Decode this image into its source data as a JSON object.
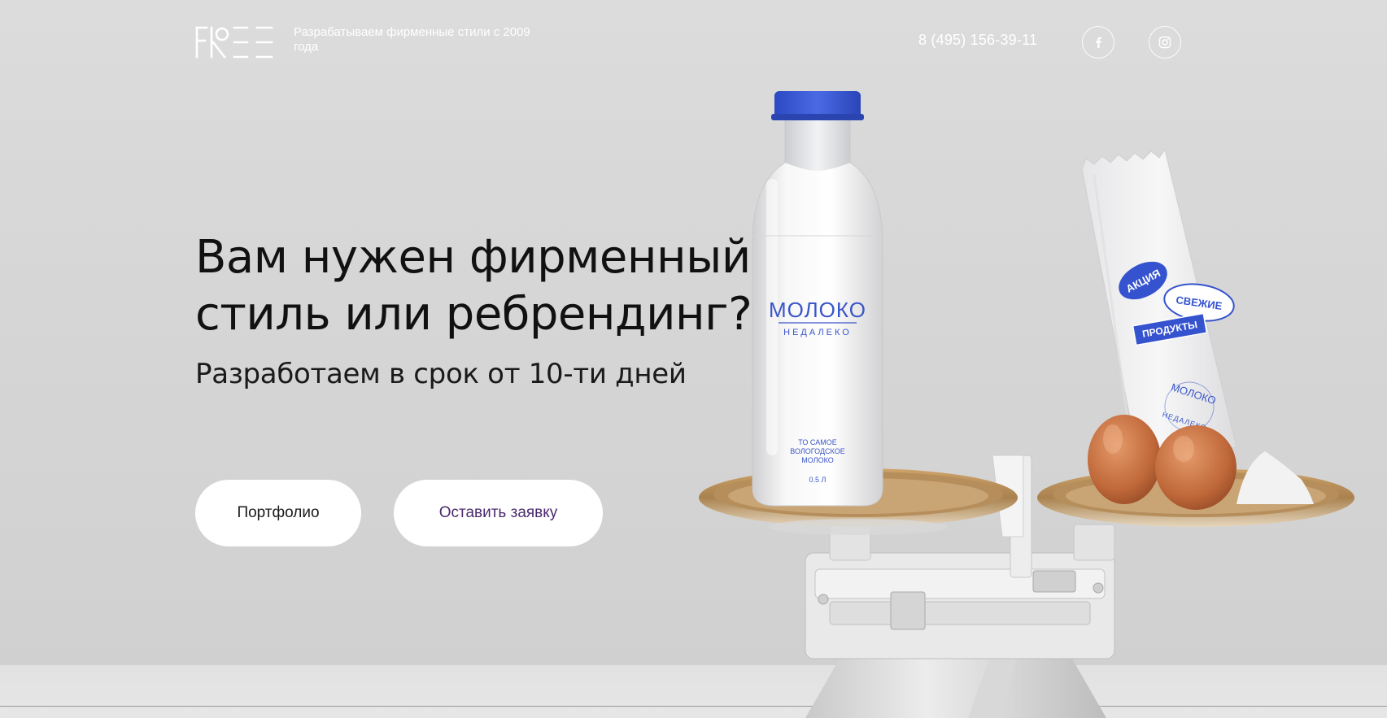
{
  "header": {
    "logo_text": "FREE",
    "tagline": "Разрабатываем фирменные стили с 2009 года",
    "phone": "8 (495) 156-39-11",
    "social": [
      {
        "name": "facebook",
        "icon": "facebook-icon"
      },
      {
        "name": "instagram",
        "icon": "instagram-icon"
      }
    ]
  },
  "hero": {
    "title_line1": "Вам нужен фирменный",
    "title_line2": "стиль или ребрендинг?",
    "subtitle": "Разработаем в срок от 10-ти дней"
  },
  "buttons": {
    "portfolio": "Портфолио",
    "request": "Оставить заявку"
  },
  "illustration": {
    "bottle_brand": "МОЛОКО",
    "bottle_sub": "НЕДАЛЕКО",
    "bottle_note_1": "ТО САМОЕ",
    "bottle_note_2": "ВОЛОГОДСКОЕ",
    "bottle_note_3": "МОЛОКО",
    "bottle_volume": "0.5 Л",
    "bag_badge_1": "АКЦИЯ",
    "bag_badge_2": "СВЕЖИЕ",
    "bag_badge_3": "ПРОДУКТЫ",
    "bag_stamp_1": "МОЛОКО",
    "bag_stamp_2": "НЕДАЛЕКО"
  },
  "colors": {
    "accent_purple": "#4a2a6e",
    "brand_blue": "#3a56c8",
    "cap_blue": "#3b5bd6",
    "background": "#d6d6d6"
  }
}
